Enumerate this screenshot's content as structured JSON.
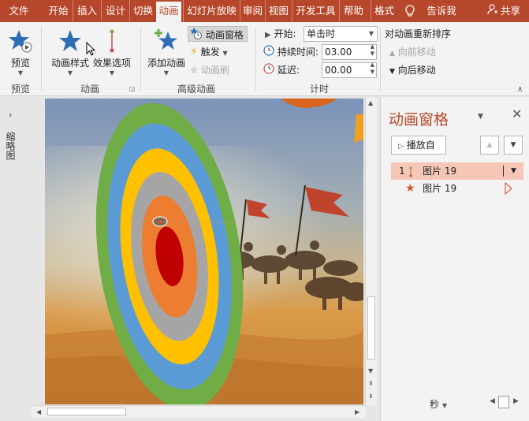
{
  "tabs": [
    {
      "label": "文件",
      "active": false
    },
    {
      "label": "开始",
      "active": false
    },
    {
      "label": "插入",
      "active": false
    },
    {
      "label": "设计",
      "active": false
    },
    {
      "label": "切换",
      "active": false
    },
    {
      "label": "动画",
      "active": true
    },
    {
      "label": "幻灯片放映",
      "active": false
    },
    {
      "label": "审阅",
      "active": false
    },
    {
      "label": "视图",
      "active": false
    },
    {
      "label": "开发工具",
      "active": false
    },
    {
      "label": "帮助",
      "active": false
    },
    {
      "label": "格式",
      "active": false
    }
  ],
  "tell_me": "告诉我",
  "share": "共享",
  "ribbon": {
    "preview": {
      "button": "预览",
      "group": "预览"
    },
    "animation": {
      "styles": "动画样式",
      "effects": "效果选项",
      "group": "动画"
    },
    "advanced": {
      "add": "添加动画",
      "pane": "动画窗格",
      "trigger": "触发",
      "painter": "动画刷",
      "group": "高级动画"
    },
    "timing": {
      "start_label": "开始:",
      "start_value": "单击时",
      "duration_label": "持续时间:",
      "duration_value": "03.00",
      "delay_label": "延迟:",
      "delay_value": "00.00",
      "group": "计时"
    },
    "reorder": {
      "title": "对动画重新排序",
      "earlier": "向前移动",
      "later": "向后移动"
    }
  },
  "left_pane": {
    "label": "缩略图"
  },
  "anim_pane": {
    "title": "动画窗格",
    "play_from": "播放自",
    "items": [
      {
        "index": "1",
        "name": "图片 19"
      },
      {
        "index": "",
        "name": "图片 19"
      }
    ],
    "timeline_unit": "秒"
  },
  "colors": {
    "accent": "#b7472a",
    "selected_row": "#f6c7b6",
    "ring_green": "#71ad47",
    "ring_blue": "#5b9bd5",
    "ring_yellow": "#ffc000",
    "ring_gray": "#a5a5a5",
    "ring_orange": "#ed7d31",
    "bullseye_red": "#c00000"
  }
}
